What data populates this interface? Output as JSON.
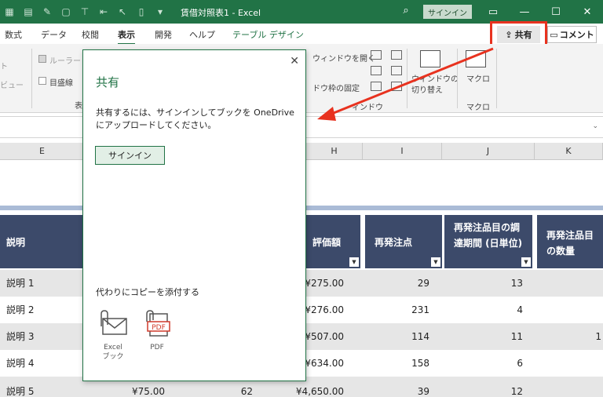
{
  "titlebar": {
    "doc_title": "賃借対照表1 - Excel",
    "signin": "サインイン",
    "quick_access": [
      "save-icon",
      "grid-icon",
      "format-painter-icon",
      "border-icon",
      "filter-icon",
      "sort-icon",
      "pointer-icon",
      "document-icon",
      "customize-icon"
    ]
  },
  "tabs": [
    "数式",
    "データ",
    "校閲",
    "表示",
    "開発",
    "ヘルプ",
    "テーブル デザイン"
  ],
  "ribbon_actions": {
    "share": "共有",
    "comment": "コメント"
  },
  "ribbon": {
    "ruler": "ルーラー",
    "gridlines": "目盛線",
    "window_open": "ウィンドウを開く",
    "freeze_panes": "ドウ枠の固定",
    "switch_windows_1": "ウィンドウの",
    "switch_windows_2": "切り替え",
    "window_group": "ィンドウ",
    "macro": "マクロ",
    "macro_group": "マクロ",
    "left_fragment_1": "ト",
    "left_fragment_2": "ビュー",
    "left_fragment_3": "表"
  },
  "columns": {
    "e": "E",
    "h": "H",
    "i": "I",
    "j": "J",
    "k": "K"
  },
  "table": {
    "headers": {
      "desc": "説明",
      "value": "評価額",
      "reorder": "再発注点",
      "lead_time": "再発注品目の調達期間 (日単位)",
      "reorder_qty": "再発注品目の数量"
    },
    "rows": [
      {
        "desc": "説明 1",
        "price": "",
        "qty": "",
        "value": "¥275.00",
        "reorder": "29",
        "lead": "13",
        "k": ""
      },
      {
        "desc": "説明 2",
        "price": "",
        "qty": "",
        "value": "¥276.00",
        "reorder": "231",
        "lead": "4",
        "k": ""
      },
      {
        "desc": "説明 3",
        "price": "",
        "qty": "",
        "value": "¥507.00",
        "reorder": "114",
        "lead": "11",
        "k": "1"
      },
      {
        "desc": "説明 4",
        "price": "",
        "qty": "",
        "value": "¥634.00",
        "reorder": "158",
        "lead": "6",
        "k": ""
      },
      {
        "desc": "説明 5",
        "price": "¥75.00",
        "qty": "62",
        "value": "¥4,650.00",
        "reorder": "39",
        "lead": "12",
        "k": ""
      }
    ]
  },
  "share_pane": {
    "title": "共有",
    "message": "共有するには、サインインしてブックを OneDrive にアップロードしてください。",
    "signin_button": "サインイン",
    "copy_heading": "代わりにコピーを添付する",
    "attachments": [
      {
        "label": "Excel\nブック",
        "icon": "excel-attachment-icon"
      },
      {
        "label": "PDF",
        "icon": "pdf-attachment-icon"
      }
    ]
  },
  "colors": {
    "excel_green": "#217346",
    "header_navy": "#3c4a6a",
    "highlight_red": "#e8321f",
    "band_blue": "#aabbd6"
  }
}
